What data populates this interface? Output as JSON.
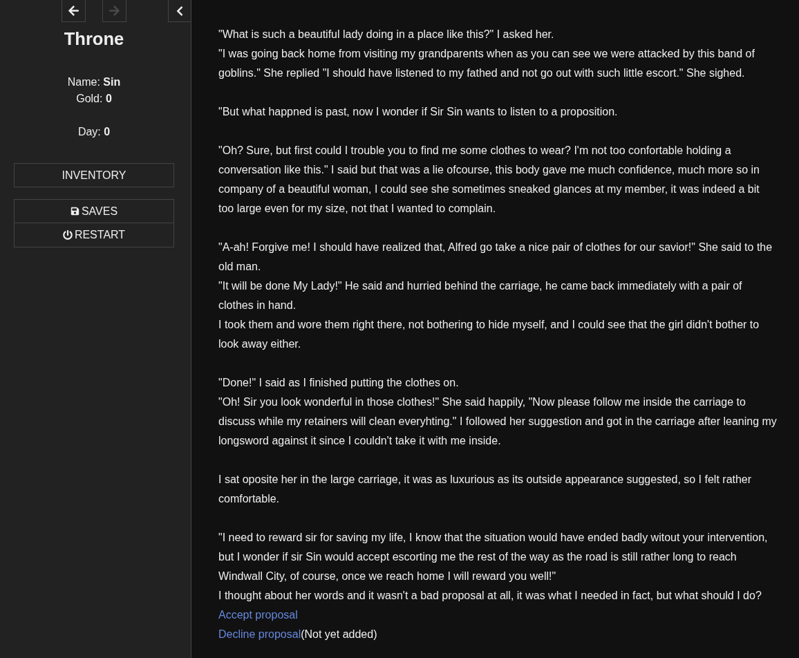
{
  "sidebar": {
    "history": [
      {
        "kind": "back",
        "disabled": false
      },
      {
        "kind": "forward",
        "disabled": true
      }
    ],
    "title": "Throne",
    "stat_groups": [
      [
        "Name: **Sin**",
        "Gold: **0**"
      ],
      [
        "Day: **0**"
      ]
    ],
    "menus": [
      [
        {
          "kind": "inventory",
          "label": "INVENTORY"
        }
      ],
      [
        {
          "kind": "saves",
          "label": "SAVES"
        },
        {
          "kind": "restart",
          "label": "RESTART"
        }
      ]
    ]
  },
  "passage": {
    "paragraphs": [
      [
        "\"What is such a beautiful lady doing in a place like this?\" I asked her.",
        "\"I was going back home from visiting my grandparents when as you can see we were attacked by this band of goblins.\" She replied \"I should have listened to my fathed and not go out with such little escort.\" She sighed."
      ],
      [
        "\"But what happned is past, now I wonder if Sir Sin wants to listen to a proposition."
      ],
      [
        "\"Oh? Sure, but first could I trouble you to find me some clothes to wear? I'm not too confortable holding a conversation like this.\" I said but that was a lie ofcourse, this body gave me much confidence, much more so in company of a beautiful woman, I could see she sometimes sneaked glances at my member, it was indeed a bit too large even for my size, not that I wanted to complain."
      ],
      [
        "\"A-ah! Forgive me! I should have realized that, Alfred go take a nice pair of clothes for our savior!\" She said to the old man.",
        "\"It will be done My Lady!\" He said and hurried behind the carriage, he came back immediately with a pair of clothes in hand.",
        "I took them and wore them right there, not bothering to hide myself, and I could see that the girl didn't bother to look away either."
      ],
      [
        "\"Done!\" I said as I finished putting the clothes on.",
        "\"Oh! Sir you look wonderful in those clothes!\" She said happily, \"Now please follow me inside the carriage to discuss while my retainers will clean everyhting.\" I followed her suggestion and got in the carriage after leaning my longsword against it since I couldn't take it with me inside."
      ],
      [
        "I sat oposite her in the large carriage, it was as luxurious as its outside appearance suggested, so I felt rather comfortable."
      ],
      [
        "\"I need to reward sir for saving my life, I know that the situation would have ended badly witout your intervention, but I wonder if sir Sin would accept escorting me the rest of the way as the road is still rather long to reach Windwall City, of course, once we reach home I will reward you well!\"",
        "I thought about her words and it wasn't a bad proposal at all, it was what I needed in fact, but what should I do?"
      ]
    ],
    "choices": [
      {
        "label": "Accept proposal"
      },
      {
        "label": "Decline proposal",
        "note": "(Not yet added)"
      }
    ]
  }
}
